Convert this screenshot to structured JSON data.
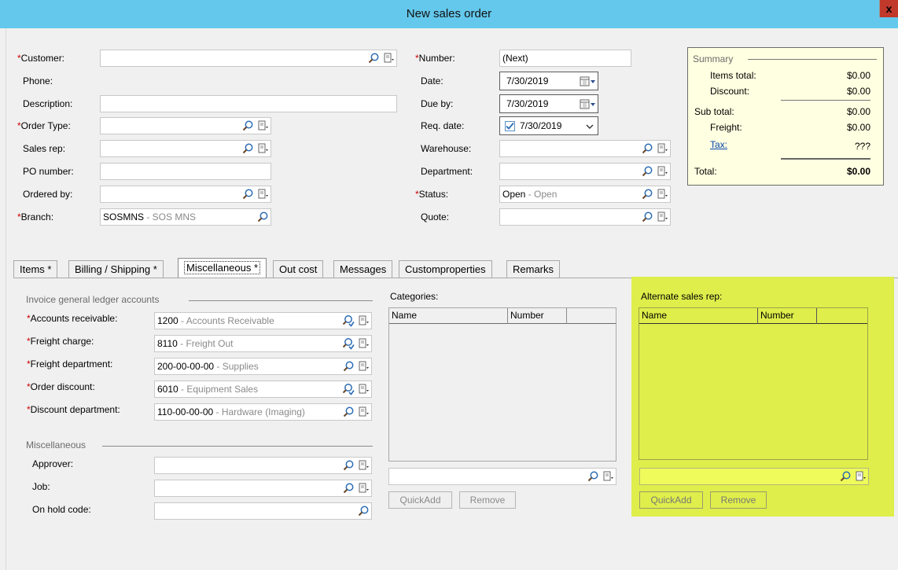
{
  "window": {
    "title": "New sales order",
    "close_glyph": "x"
  },
  "header": {
    "customer": {
      "label": "Customer:",
      "value": ""
    },
    "phone": {
      "label": "Phone:"
    },
    "description": {
      "label": "Description:",
      "value": ""
    },
    "order_type": {
      "label": "Order Type:",
      "value": ""
    },
    "sales_rep": {
      "label": "Sales rep:",
      "value": ""
    },
    "po_number": {
      "label": "PO number:",
      "value": ""
    },
    "ordered_by": {
      "label": "Ordered by:",
      "value": ""
    },
    "branch": {
      "label": "Branch:",
      "code": "SOSMNS",
      "desc": " - SOS MNS"
    },
    "number": {
      "label": "Number:",
      "value": "(Next)"
    },
    "date": {
      "label": "Date:",
      "value": "7/30/2019"
    },
    "due_by": {
      "label": "Due by:",
      "value": "7/30/2019"
    },
    "req_date": {
      "label": "Req. date:",
      "value": "7/30/2019",
      "checked": true
    },
    "warehouse": {
      "label": "Warehouse:",
      "value": ""
    },
    "department": {
      "label": "Department:",
      "value": ""
    },
    "status": {
      "label": "Status:",
      "code": "Open",
      "desc": " - Open"
    },
    "quote": {
      "label": "Quote:",
      "value": ""
    }
  },
  "summary": {
    "caption": "Summary",
    "items_total_label": "Items total:",
    "items_total": "$0.00",
    "discount_label": "Discount:",
    "discount": "$0.00",
    "sub_total_label": "Sub total:",
    "sub_total": "$0.00",
    "freight_label": "Freight:",
    "freight": "$0.00",
    "tax_label": "Tax:",
    "tax": "???",
    "total_label": "Total:",
    "total": "$0.00"
  },
  "tabs": [
    {
      "label": "Items *"
    },
    {
      "label": "Billing / Shipping  *"
    },
    {
      "label": "Miscellaneous *",
      "active": true
    },
    {
      "label": "Out cost"
    },
    {
      "label": "Messages"
    },
    {
      "label": "Customproperties"
    },
    {
      "label": "Remarks"
    }
  ],
  "misc": {
    "gl_caption": "Invoice general ledger accounts",
    "accounts_receivable": {
      "label": "Accounts receivable:",
      "code": "1200",
      "desc": " - Accounts Receivable"
    },
    "freight_charge": {
      "label": "Freight charge:",
      "code": "8110",
      "desc": " - Freight Out"
    },
    "freight_department": {
      "label": "Freight department:",
      "code": "200-00-00-00",
      "desc": " - Supplies"
    },
    "order_discount": {
      "label": "Order discount:",
      "code": "6010",
      "desc": " - Equipment Sales"
    },
    "discount_department": {
      "label": "Discount department:",
      "code": "110-00-00-00",
      "desc": " - Hardware (Imaging)"
    },
    "misc_caption": "Miscellaneous",
    "approver": {
      "label": "Approver:",
      "value": ""
    },
    "job": {
      "label": "Job:",
      "value": ""
    },
    "on_hold_code": {
      "label": "On hold code:",
      "value": ""
    }
  },
  "categories": {
    "caption": "Categories:",
    "columns": [
      "Name",
      "Number"
    ],
    "search_value": "",
    "quickadd": "QuickAdd",
    "remove": "Remove"
  },
  "alternate_sales_rep": {
    "caption": "Alternate sales rep:",
    "columns": [
      "Name",
      "Number"
    ],
    "search_value": "",
    "quickadd": "QuickAdd",
    "remove": "Remove",
    "highlight_color": "#dfee4b"
  }
}
